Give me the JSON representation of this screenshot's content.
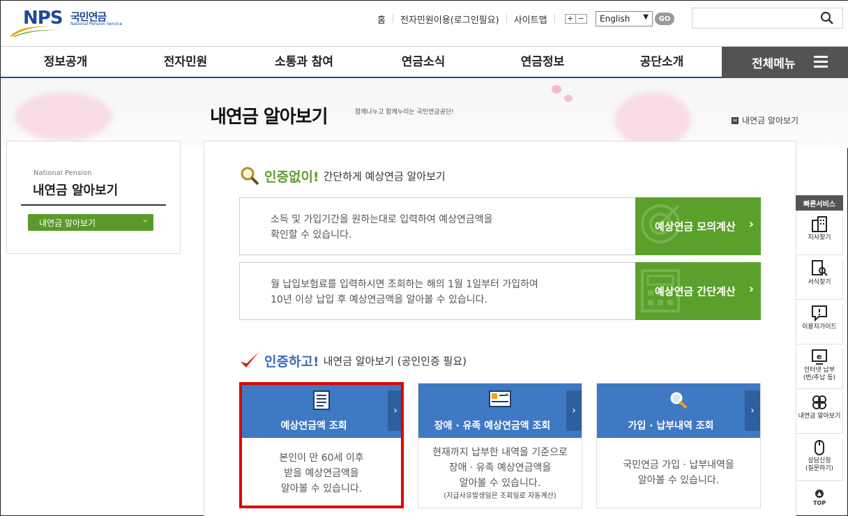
{
  "logo": {
    "nps": "NPS",
    "kr": "국민연금",
    "en": "National Pension Service"
  },
  "util": {
    "home": "홈",
    "login": "전자민원이용(로그인필요)",
    "sitemap": "사이트맵",
    "zoom_in": "+",
    "zoom_out": "−"
  },
  "lang": {
    "selected": "English",
    "go": "GO"
  },
  "search": {
    "placeholder": ""
  },
  "gnb": {
    "items": [
      "정보공개",
      "전자민원",
      "소통과 참여",
      "연금소식",
      "연금정보",
      "공단소개"
    ],
    "all_menu": "전체메뉴"
  },
  "page": {
    "title": "내연금 알아보기",
    "subtitle": "함께나누고 함께누리는 국민연금공단!",
    "location": "내연금 알아보기"
  },
  "lnb": {
    "en": "National Pension",
    "title": "내연금 알아보기",
    "button": "내연금 알아보기"
  },
  "section1": {
    "big": "인증없이!",
    "rest": "간단하게 예상연금 알아보기",
    "rows": [
      {
        "line1": "소득 및 가입기간을 원하는대로 입력하여 예상연금액을",
        "line2": "확인할 수 있습니다.",
        "button": "예상연금 모의계산"
      },
      {
        "line1": "월 납입보험료를 입력하시면 조회하는 해의 1월 1일부터 가입하여",
        "line2": "10년 이상 납입 후 예상연금액을 알아볼 수 있습니다.",
        "button": "예상연금 간단계산"
      }
    ]
  },
  "section2": {
    "big": "인증하고!",
    "rest": "내연금 알아보기 (공인인증 필요)",
    "cards": [
      {
        "title": "예상연금액 조회",
        "line1": "본인이 만 60세 이후",
        "line2": "받을 예상연금액을",
        "line3": "알아볼 수 있습니다.",
        "note": ""
      },
      {
        "title": "장애 · 유족 예상연금액 조회",
        "line1": "현재까지 납부한 내역을 기준으로",
        "line2": "장애 · 유족 예상연금액을",
        "line3": "알아볼 수 있습니다.",
        "note": "(지급사유발생일은 조회일로 자동계산)"
      },
      {
        "title": "가입 · 납부내역 조회",
        "line1": "국민연금 가입 · 납부내역을",
        "line2": "알아볼 수 있습니다.",
        "line3": "",
        "note": ""
      }
    ]
  },
  "quick": {
    "title": "빠른서비스",
    "items": [
      {
        "label1": "지사찾기",
        "label2": ""
      },
      {
        "label1": "서식찾기",
        "label2": ""
      },
      {
        "label1": "이용자가이드",
        "label2": ""
      },
      {
        "label1": "인터넷 납부",
        "label2": "(반/추납 등)"
      },
      {
        "label1": "내연금 알아보기",
        "label2": ""
      },
      {
        "label1": "상담신청",
        "label2": "(질문하기)"
      }
    ],
    "top": "TOP"
  },
  "colors": {
    "brand_blue": "#1d4a9b",
    "green": "#5aa02a",
    "card_blue": "#3f78c3",
    "highlight_red": "#e00000"
  }
}
